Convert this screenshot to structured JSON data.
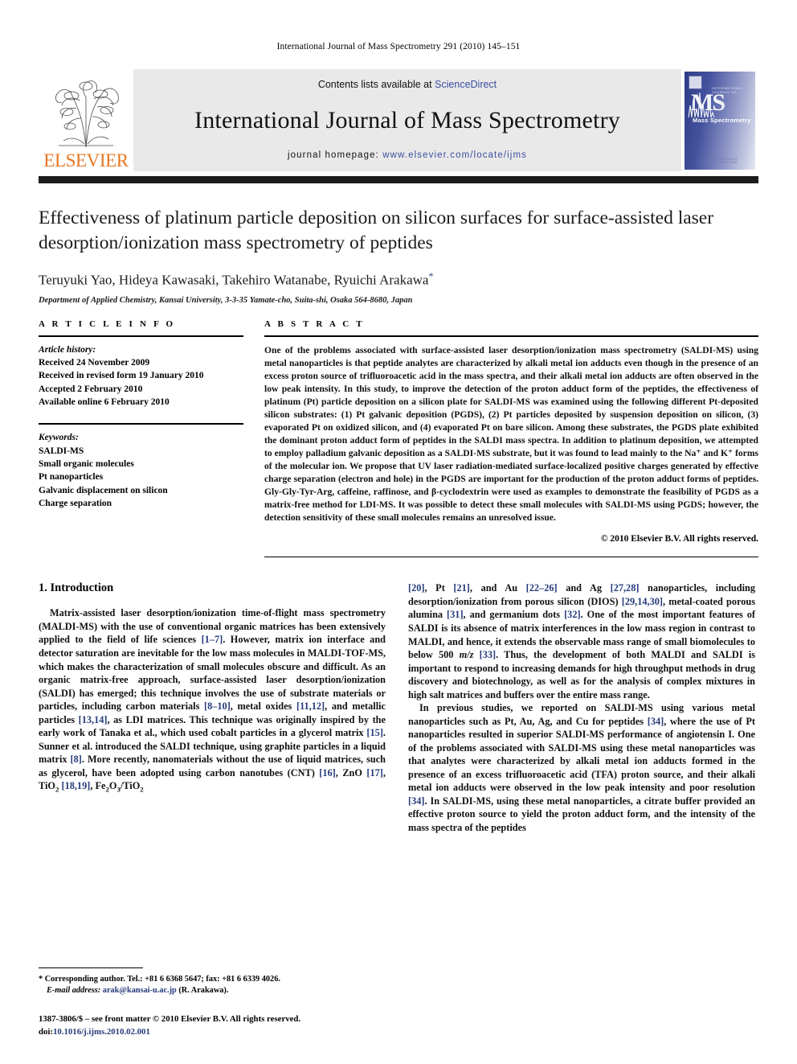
{
  "running_head": "International Journal of Mass Spectrometry 291 (2010) 145–151",
  "masthead": {
    "publisher": "ELSEVIER",
    "contents_prefix": "Contents lists available at ",
    "contents_link": "ScienceDirect",
    "journal_title": "International Journal of Mass Spectrometry",
    "homepage_prefix": "journal homepage: ",
    "homepage_url": "www.elsevier.com/locate/ijms",
    "cover": {
      "logo_text": "MS",
      "label": "Mass Spectrometry",
      "top_note": "INTERNATIONAL JOURNAL OF",
      "bottom_note": "AVAILABLE ONLINE AT SCIENCEDIRECT.COM"
    }
  },
  "article": {
    "title": "Effectiveness of platinum particle deposition on silicon surfaces for surface-assisted laser desorption/ionization mass spectrometry of peptides",
    "authors": "Teruyuki Yao, Hideya Kawasaki, Takehiro Watanabe, Ryuichi Arakawa",
    "corresponding_marker": "*",
    "affiliation": "Department of Applied Chemistry, Kansai University, 3-3-35 Yamate-cho, Suita-shi, Osaka 564-8680, Japan"
  },
  "article_info": {
    "label": "A R T I C L E    I N F O",
    "history_label": "Article history:",
    "history": [
      "Received 24 November 2009",
      "Received in revised form 19 January 2010",
      "Accepted 2 February 2010",
      "Available online 6 February 2010"
    ],
    "keywords_label": "Keywords:",
    "keywords": [
      "SALDI-MS",
      "Small organic molecules",
      "Pt nanoparticles",
      "Galvanic displacement on silicon",
      "Charge separation"
    ]
  },
  "abstract": {
    "label": "A B S T R A C T",
    "text": "One of the problems associated with surface-assisted laser desorption/ionization mass spectrometry (SALDI-MS) using metal nanoparticles is that peptide analytes are characterized by alkali metal ion adducts even though in the presence of an excess proton source of trifluoroacetic acid in the mass spectra, and their alkali metal ion adducts are often observed in the low peak intensity. In this study, to improve the detection of the proton adduct form of the peptides, the effectiveness of platinum (Pt) particle deposition on a silicon plate for SALDI-MS was examined using the following different Pt-deposited silicon substrates: (1) Pt galvanic deposition (PGDS), (2) Pt particles deposited by suspension deposition on silicon, (3) evaporated Pt on oxidized silicon, and (4) evaporated Pt on bare silicon. Among these substrates, the PGDS plate exhibited the dominant proton adduct form of peptides in the SALDI mass spectra. In addition to platinum deposition, we attempted to employ palladium galvanic deposition as a SALDI-MS substrate, but it was found to lead mainly to the Na⁺ and K⁺ forms of the molecular ion. We propose that UV laser radiation-mediated surface-localized positive charges generated by effective charge separation (electron and hole) in the PGDS are important for the production of the proton adduct forms of peptides. Gly-Gly-Tyr-Arg, caffeine, raffinose, and β-cyclodextrin were used as examples to demonstrate the feasibility of PGDS as a matrix-free method for LDI-MS. It was possible to detect these small molecules with SALDI-MS using PGDS; however, the detection sensitivity of these small molecules remains an unresolved issue.",
    "copyright": "© 2010 Elsevier B.V. All rights reserved."
  },
  "body": {
    "section_number_title": "1.  Introduction",
    "left_paragraph_1_a": "Matrix-assisted laser desorption/ionization time-of-flight mass spectrometry (MALDI-MS) with the use of conventional organic matrices has been extensively applied to the field of life sciences ",
    "ref_1_7": "[1–7]",
    "left_paragraph_1_b": ". However, matrix ion interface and detector saturation are inevitable for the low mass molecules in MALDI-TOF-MS, which makes the characterization of small molecules obscure and difficult. As an organic matrix-free approach, surface-assisted laser desorption/ionization (SALDI) has emerged; this technique involves the use of substrate materials or particles, including carbon materials ",
    "ref_8_10": "[8–10]",
    "left_paragraph_1_c": ", metal oxides ",
    "ref_11_12": "[11,12]",
    "left_paragraph_1_d": ", and metallic particles ",
    "ref_13_14": "[13,14]",
    "left_paragraph_1_e": ", as LDI matrices. This technique was originally inspired by the early work of Tanaka et al., which used cobalt particles in a glycerol matrix ",
    "ref_15": "[15]",
    "left_paragraph_1_f": ". Sunner et al. introduced the SALDI technique, using graphite particles in a liquid matrix ",
    "ref_8": "[8]",
    "left_paragraph_1_g": ". More recently, nanomaterials without the use of liquid matrices, such as glycerol, have been adopted using carbon nanotubes (CNT) ",
    "ref_16": "[16]",
    "left_paragraph_1_h": ", ZnO ",
    "ref_17": "[17]",
    "left_paragraph_1_i": ", TiO",
    "ref_18_19": "[18,19]",
    "left_tail": ", Fe",
    "right_paragraph_1_a": "",
    "ref_20": "[20]",
    "right_1_b": ", Pt ",
    "ref_21": "[21]",
    "right_1_c": ", and Au ",
    "ref_22_26": "[22–26]",
    "right_1_d": " and Ag ",
    "ref_27_28": "[27,28]",
    "right_1_e": " nanoparticles, including desorption/ionization from porous silicon (DIOS) ",
    "ref_29_14_30": "[29,14,30]",
    "right_1_f": ", metal-coated porous alumina ",
    "ref_31": "[31]",
    "right_1_g": ", and germanium dots ",
    "ref_32": "[32]",
    "right_1_h": ". One of the most important features of SALDI is its absence of matrix interferences in the low mass region in contrast to MALDI, and hence, it extends the observable mass range of small biomolecules to below 500 ",
    "mz_italic": "m/z",
    "ref_33": "[33]",
    "right_1_i": ". Thus, the development of both MALDI and SALDI is important to respond to increasing demands for high throughput methods in drug discovery and biotechnology, as well as for the analysis of complex mixtures in high salt matrices and buffers over the entire mass range.",
    "right_paragraph_2_a": "In previous studies, we reported on SALDI-MS using various metal nanoparticles such as Pt, Au, Ag, and Cu for peptides ",
    "ref_34": "[34]",
    "right_2_b": ", where the use of Pt nanoparticles resulted in superior SALDI-MS performance of angiotensin I. One of the problems associated with SALDI-MS using these metal nanoparticles was that analytes were characterized by alkali metal ion adducts formed in the presence of an excess trifluoroacetic acid (TFA) proton source, and their alkali metal ion adducts were observed in the low peak intensity and poor resolution ",
    "ref_34_b": "[34]",
    "right_2_c": ". In SALDI-MS, using these metal nanoparticles, a citrate buffer provided an effective proton source to yield the proton adduct form, and the intensity of the mass spectra of the peptides"
  },
  "footer": {
    "corresponding": "* Corresponding author. Tel.: +81 6 6368 5647; fax: +81 6 6339 4026.",
    "email_label": "E-mail address:",
    "email": "arak@kansai-u.ac.jp",
    "email_suffix": " (R. Arakawa).",
    "issn": "1387-3806/$ – see front matter © 2010 Elsevier B.V. All rights reserved.",
    "doi_label": "doi:",
    "doi": "10.1016/j.ijms.2010.02.001"
  }
}
